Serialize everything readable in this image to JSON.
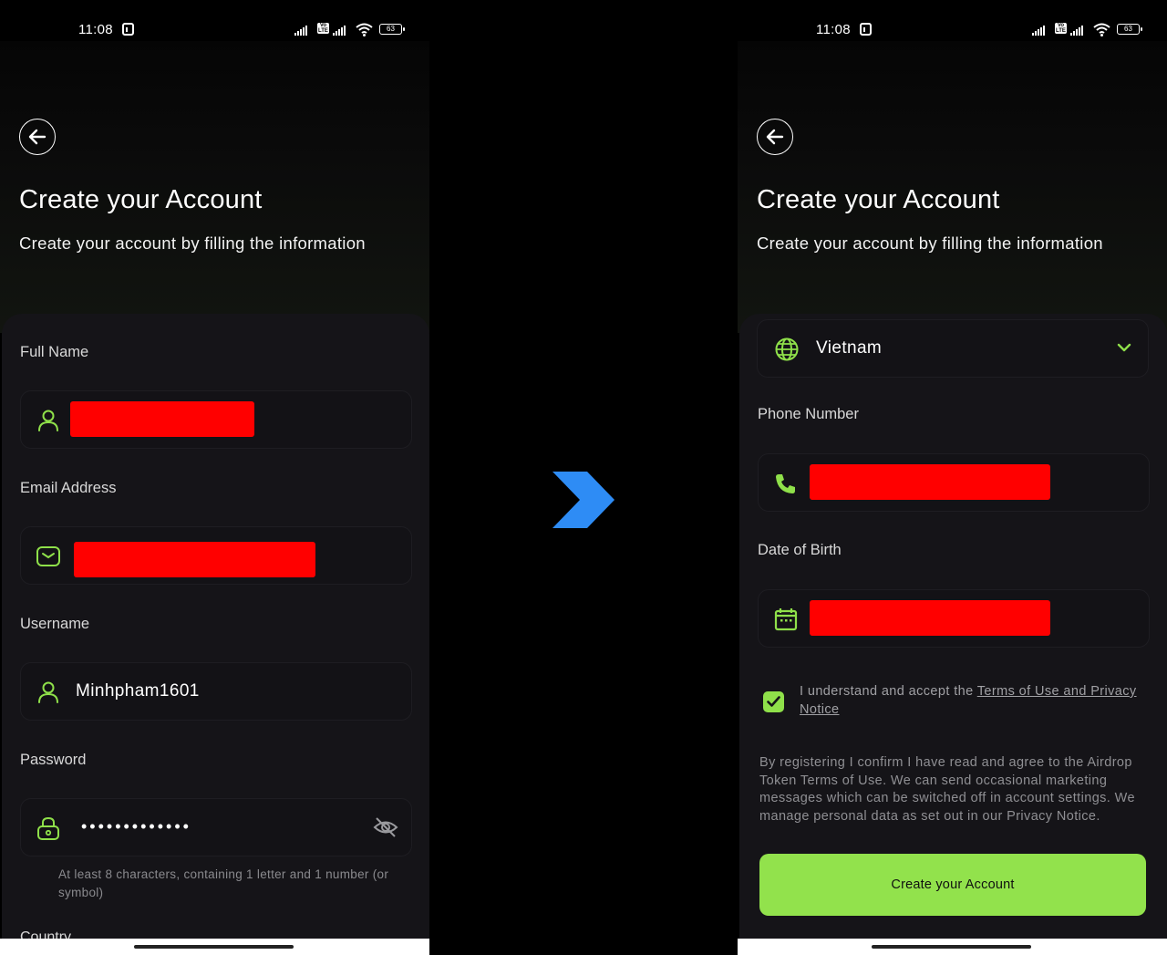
{
  "status_bar": {
    "time": "11:08",
    "battery": "63"
  },
  "colors": {
    "accent": "#92e24c",
    "icon_green": "#8fe04a",
    "redaction": "#ff0000",
    "arrow_blue": "#2e8cf5",
    "card_bg": "#151418"
  },
  "left_screen": {
    "title": "Create your Account",
    "subtitle": "Create your account by filling the information",
    "fields": {
      "full_name": {
        "label": "Full Name",
        "icon": "user-icon"
      },
      "email": {
        "label": "Email Address",
        "icon": "mail-icon"
      },
      "username": {
        "label": "Username",
        "icon": "user-icon",
        "value": "Minhpham1601"
      },
      "password": {
        "label": "Password",
        "icon": "lock-icon",
        "value": "•••••••••••••",
        "hint": "At least 8 characters, containing 1 letter and 1 number (or symbol)"
      }
    },
    "cut_off_label": "Country"
  },
  "transition_arrow": "chevron-right-icon",
  "right_screen": {
    "title": "Create your Account",
    "subtitle": "Create your account by filling the information",
    "country": {
      "value": "Vietnam",
      "icon": "globe-icon"
    },
    "fields": {
      "phone": {
        "label": "Phone Number",
        "icon": "phone-icon"
      },
      "dob": {
        "label": "Date of Birth",
        "icon": "calendar-icon"
      }
    },
    "terms": {
      "prefix": "I understand and accept the ",
      "link": "Terms of Use and Privacy Notice",
      "checked": true
    },
    "legal_text": "By registering I confirm I have read and agree to the Airdrop Token Terms of Use. We can send occasional marketing messages which can be switched off in account settings. We manage personal data as set out in our Privacy Notice.",
    "submit_label": "Create your Account"
  }
}
